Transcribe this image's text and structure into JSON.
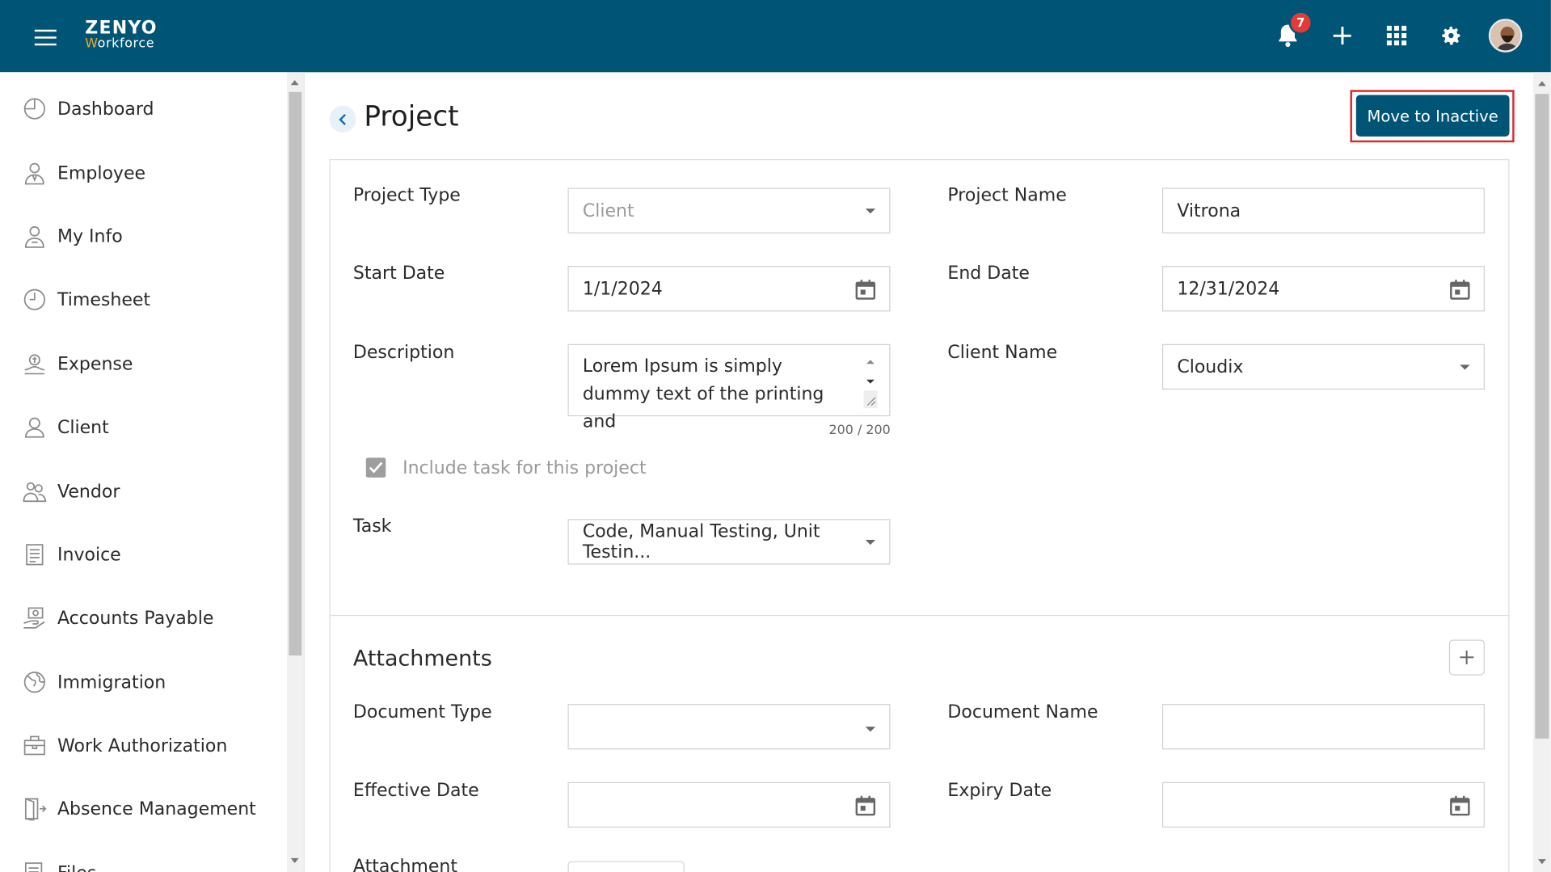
{
  "app": {
    "logo_top": "ZENYO",
    "logo_w": "W",
    "logo_rest": "orkforce",
    "notification_count": "7"
  },
  "sidebar": {
    "items": [
      {
        "label": "Dashboard",
        "icon": "dashboard-icon"
      },
      {
        "label": "Employee",
        "icon": "employee-icon"
      },
      {
        "label": "My Info",
        "icon": "my-info-icon"
      },
      {
        "label": "Timesheet",
        "icon": "clock-icon"
      },
      {
        "label": "Expense",
        "icon": "expense-icon"
      },
      {
        "label": "Client",
        "icon": "person-icon"
      },
      {
        "label": "Vendor",
        "icon": "vendor-icon"
      },
      {
        "label": "Invoice",
        "icon": "invoice-icon"
      },
      {
        "label": "Accounts Payable",
        "icon": "accounts-payable-icon"
      },
      {
        "label": "Immigration",
        "icon": "globe-icon"
      },
      {
        "label": "Work Authorization",
        "icon": "briefcase-icon"
      },
      {
        "label": "Absence Management",
        "icon": "door-icon"
      },
      {
        "label": "Files",
        "icon": "files-icon"
      }
    ]
  },
  "page": {
    "title": "Project",
    "move_inactive_label": "Move to Inactive"
  },
  "form": {
    "project_type_label": "Project Type",
    "project_type_value": "Client",
    "project_name_label": "Project Name",
    "project_name_value": "Vitrona",
    "start_date_label": "Start Date",
    "start_date_value": "1/1/2024",
    "end_date_label": "End Date",
    "end_date_value": "12/31/2024",
    "description_label": "Description",
    "description_value": "Lorem Ipsum is simply dummy text of the printing and",
    "description_counter": "200 / 200",
    "client_name_label": "Client Name",
    "client_name_value": "Cloudix",
    "include_task_label": "Include task for this project",
    "task_label": "Task",
    "task_value": "Code, Manual Testing, Unit Testin..."
  },
  "attachments": {
    "title": "Attachments",
    "document_type_label": "Document Type",
    "document_type_value": "",
    "document_name_label": "Document Name",
    "document_name_value": "",
    "effective_date_label": "Effective Date",
    "effective_date_value": "",
    "expiry_date_label": "Expiry Date",
    "expiry_date_value": "",
    "attachment_label": "Attachment"
  },
  "colors": {
    "header": "#005475",
    "accent": "#005475",
    "badge": "#e53935",
    "highlight_border": "#e02424"
  }
}
